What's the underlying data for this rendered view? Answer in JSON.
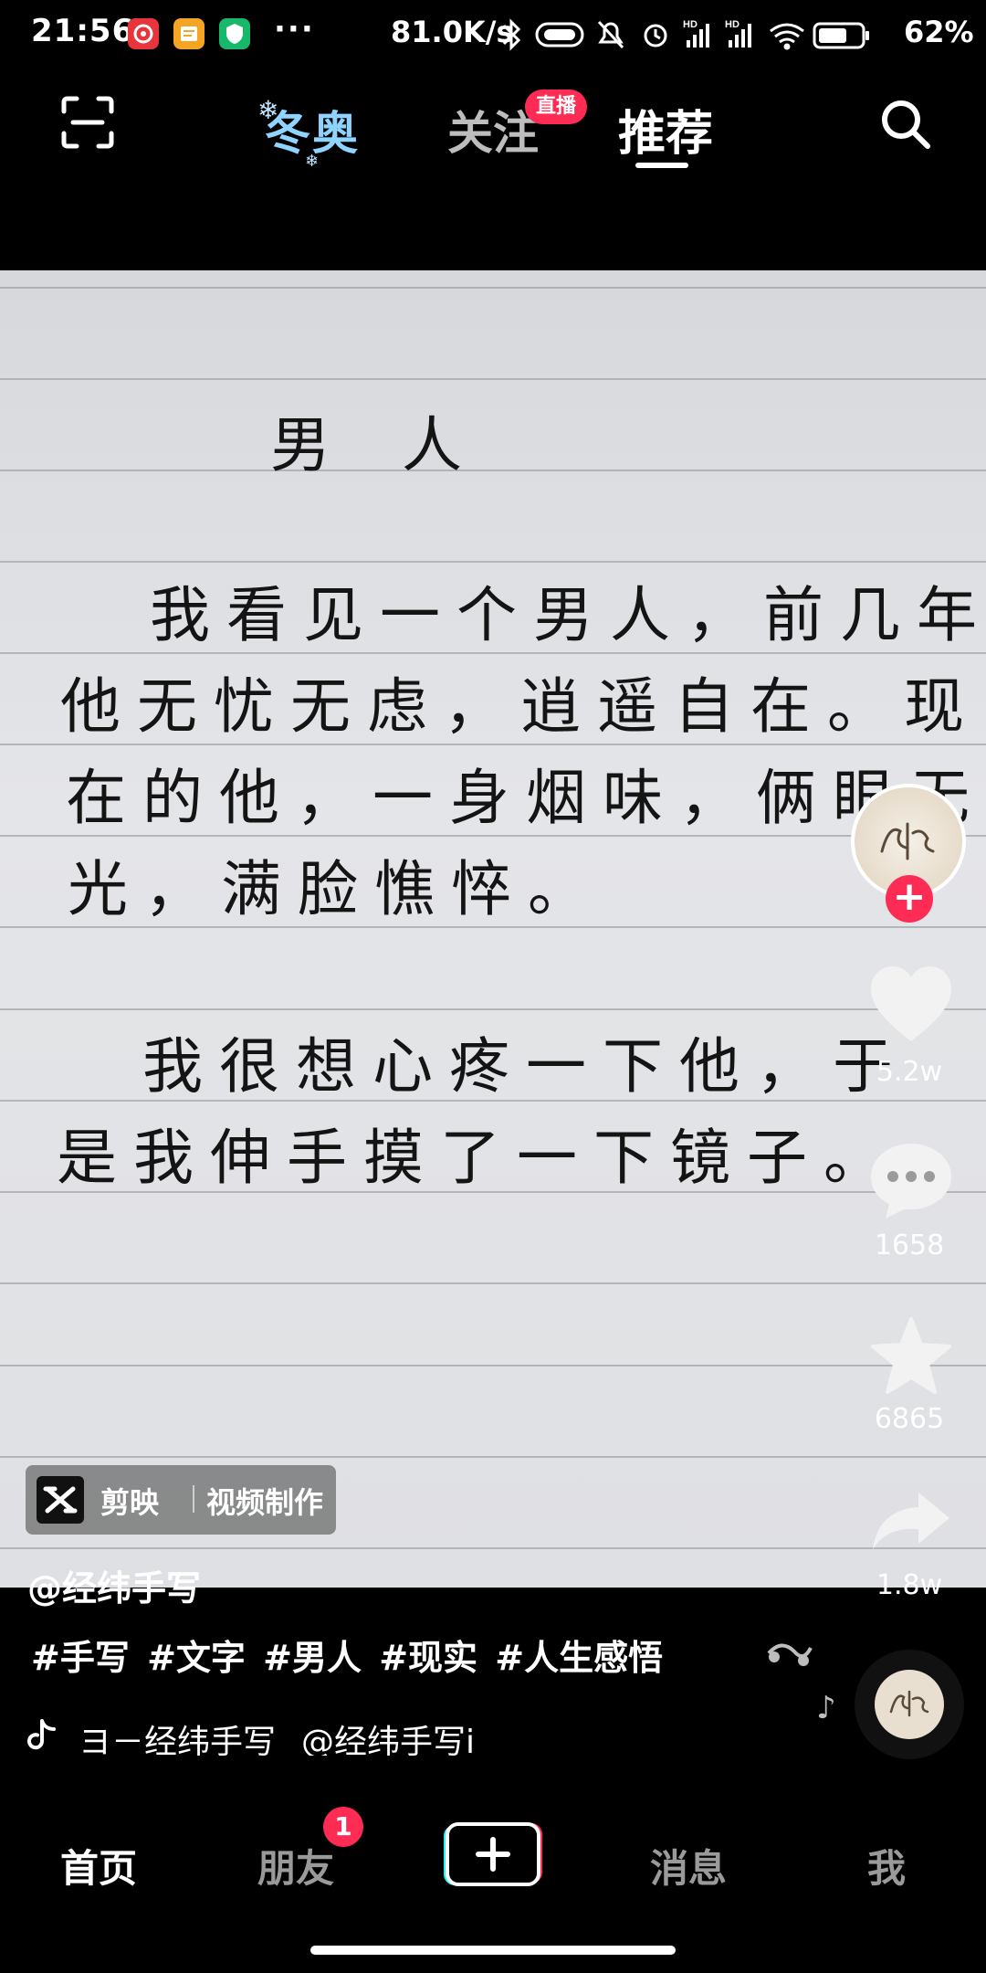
{
  "status_bar": {
    "time": "21:56",
    "more_dots": "···",
    "net_speed": "81.0K/s",
    "battery_percent": "62%"
  },
  "top_nav": {
    "winter_tab": "冬奥",
    "follow_tab": "关注",
    "live_badge": "直播",
    "recommend_tab": "推荐"
  },
  "video": {
    "handwriting": {
      "title": "男人",
      "lines": [
        "我看见一个男人，前几年",
        "他无忧无虑，逍遥自在。现",
        "在的他，一身烟味，俩眼无",
        "光，满脸憔悴。",
        "我很想心疼一下他，于",
        "是我伸手摸了一下镜子。"
      ]
    },
    "watermark": {
      "brand": "剪映",
      "tag": "视频制作"
    }
  },
  "right_rail": {
    "like_count": "5.2w",
    "comment_count": "1658",
    "favorite_count": "6865",
    "share_count": "1.8w"
  },
  "caption": {
    "author": "@经纬手写",
    "hashtags": "#手写 #文字 #男人 #现实 #人生感悟",
    "music_text1": "ヨ－经纬手写",
    "music_text2": "@经纬手写i"
  },
  "bottom_nav": {
    "home": "首页",
    "friends": "朋友",
    "friends_badge": "1",
    "messages": "消息",
    "me": "我"
  },
  "colors": {
    "accent": "#fe2c55",
    "winter": "#8fd3ff",
    "background": "#000000"
  }
}
